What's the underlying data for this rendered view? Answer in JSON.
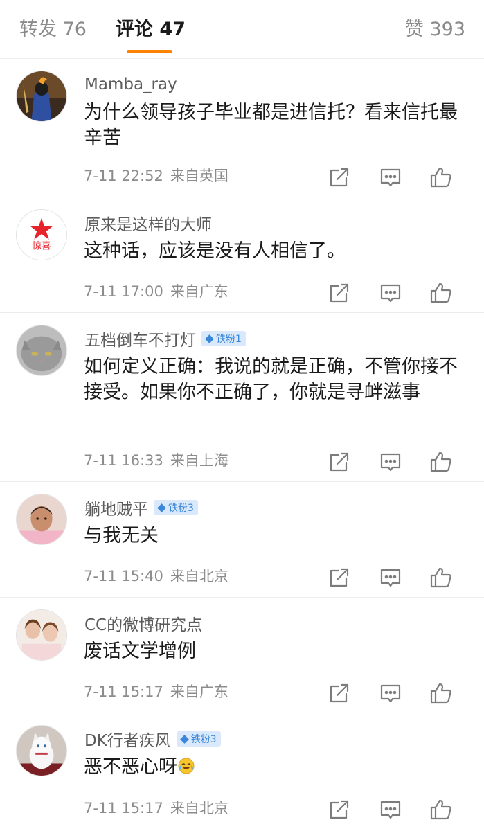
{
  "tabs": {
    "repost": "转发 76",
    "comment": "评论 47",
    "like": "赞 393"
  },
  "comments": [
    {
      "user": "Mamba_ray",
      "badge": "",
      "text": "为什么领导孩子毕业都是进信托？看来信托最辛苦",
      "time": "7-11 22:52",
      "source": "来自英国"
    },
    {
      "user": "原来是这样的大师",
      "badge": "",
      "text": "这种话，应该是没有人相信了。",
      "time": "7-11 17:00",
      "source": "来自广东",
      "avatar_text": "惊喜"
    },
    {
      "user": "五档倒车不打灯",
      "badge": "铁粉1",
      "text": "如何定义正确：我说的就是正确，不管你接不接受。如果你不正确了，你就是寻衅滋事",
      "time": "7-11 16:33",
      "source": "来自上海"
    },
    {
      "user": "躺地贼平",
      "badge": "铁粉3",
      "text": "与我无关",
      "time": "7-11 15:40",
      "source": "来自北京"
    },
    {
      "user": "CC的微博研究点",
      "badge": "",
      "text": "废话文学增例",
      "time": "7-11 15:17",
      "source": "来自广东"
    },
    {
      "user": "DK行者疾风",
      "badge": "铁粉3",
      "text": "恶不恶心呀",
      "time": "7-11 15:17",
      "source": "来自北京"
    }
  ],
  "icons": {
    "share": "share-icon",
    "reply": "comment-icon",
    "like": "thumbs-up-icon",
    "crying_emoji": "crying-laughing-emoji"
  },
  "colors": {
    "accent": "#ff8200",
    "badge_bg": "#d9e9fb",
    "badge_text": "#3a86d8",
    "icon_gray": "#7c7c7c"
  }
}
